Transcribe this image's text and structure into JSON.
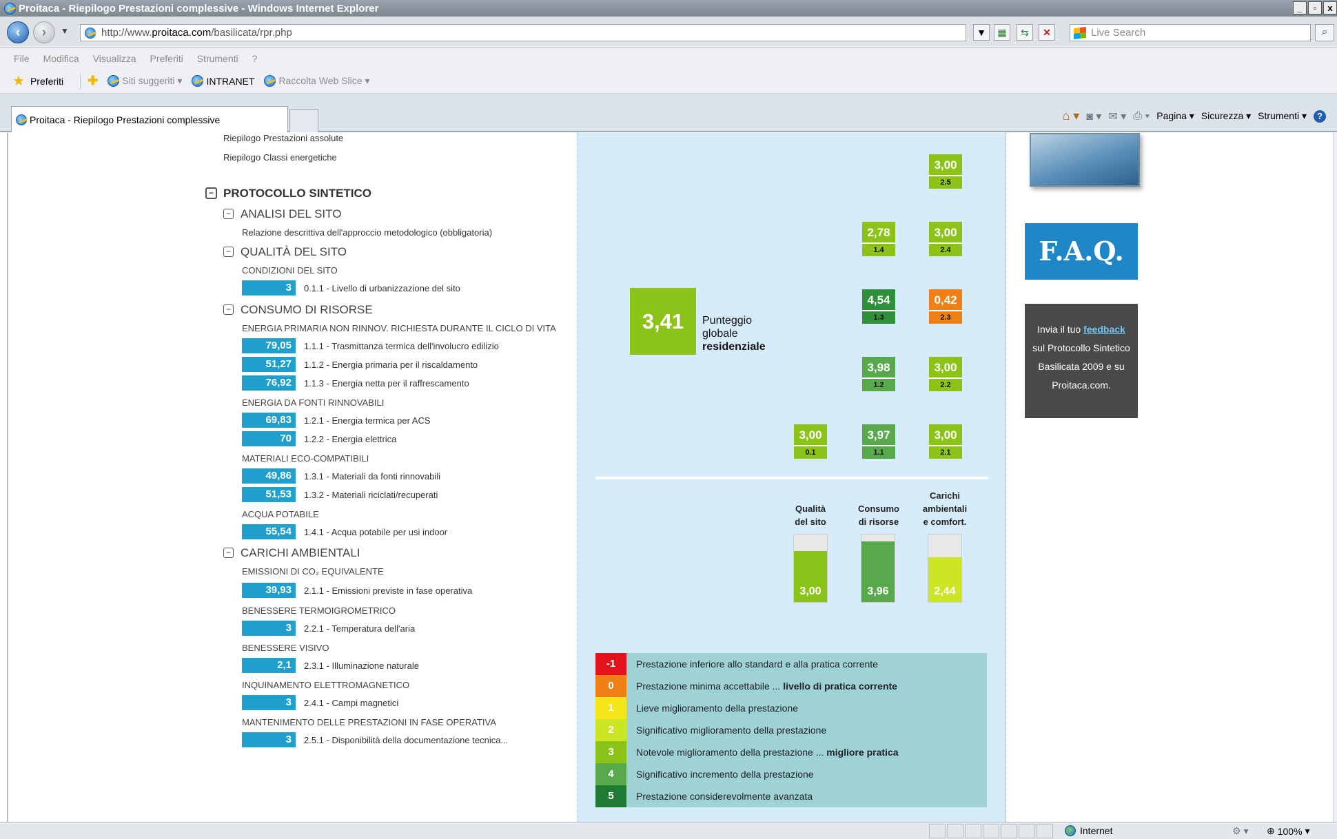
{
  "window": {
    "title": "Proitaca - Riepilogo Prestazioni complessive - Windows Internet Explorer",
    "controls": [
      "_",
      "▫",
      "x"
    ]
  },
  "address_bar": {
    "url_prefix": "http://www.",
    "url_domain": "proitaca.com",
    "url_path": "/basilicata/rpr.php",
    "search_placeholder": "Live Search"
  },
  "menu": [
    "File",
    "Modifica",
    "Visualizza",
    "Preferiti",
    "Strumenti",
    "?"
  ],
  "favorites_bar": {
    "favorites": "Preferiti",
    "items": [
      "Siti suggeriti ▾",
      "INTRANET",
      "Raccolta Web Slice ▾"
    ]
  },
  "tab": {
    "title": "Proitaca - Riepilogo Prestazioni complessive"
  },
  "command_bar": {
    "items": [
      "Pagina ▾",
      "Sicurezza ▾",
      "Strumenti ▾"
    ]
  },
  "nav": {
    "top_links": [
      "Riepilogo Prestazioni assolute",
      "Riepilogo Classi energetiche"
    ],
    "protocol": "PROTOCOLLO SINTETICO",
    "analisi": {
      "title": "ANALISI DEL SITO",
      "desc": "Relazione descrittiva dell'approccio metodologico (obbligatoria)"
    },
    "qualita": {
      "title": "QUALITÀ DEL SITO",
      "sub": "CONDIZIONI DEL SITO",
      "rows": [
        {
          "value": "3",
          "label": "0.1.1 - Livello di urbanizzazione del sito"
        }
      ]
    },
    "consumo": {
      "title": "CONSUMO DI RISORSE",
      "groups": [
        {
          "sub": "ENERGIA PRIMARIA NON RINNOV. RICHIESTA DURANTE IL CICLO DI VITA",
          "rows": [
            {
              "value": "79,05",
              "label": "1.1.1 - Trasmittanza termica dell'involucro edilizio"
            },
            {
              "value": "51,27",
              "label": "1.1.2 - Energia primaria per il riscaldamento"
            },
            {
              "value": "76,92",
              "label": "1.1.3 - Energia netta per il raffrescamento"
            }
          ]
        },
        {
          "sub": "ENERGIA DA FONTI RINNOVABILI",
          "rows": [
            {
              "value": "69,83",
              "label": "1.2.1 - Energia termica per ACS"
            },
            {
              "value": "70",
              "label": "1.2.2 - Energia elettrica"
            }
          ]
        },
        {
          "sub": "MATERIALI ECO-COMPATIBILI",
          "rows": [
            {
              "value": "49,86",
              "label": "1.3.1 - Materiali da fonti rinnovabili"
            },
            {
              "value": "51,53",
              "label": "1.3.2 - Materiali riciclati/recuperati"
            }
          ]
        },
        {
          "sub": "ACQUA POTABILE",
          "rows": [
            {
              "value": "55,54",
              "label": "1.4.1 - Acqua potabile per usi indoor"
            }
          ]
        }
      ]
    },
    "carichi": {
      "title": "CARICHI AMBIENTALI",
      "groups": [
        {
          "sub": "EMISSIONI DI CO₂ EQUIVALENTE",
          "rows": [
            {
              "value": "39,93",
              "label": "2.1.1 - Emissioni previste in fase operativa"
            }
          ]
        },
        {
          "sub": "BENESSERE TERMOIGROMETRICO",
          "rows": [
            {
              "value": "3",
              "label": "2.2.1 - Temperatura dell'aria"
            }
          ]
        },
        {
          "sub": "BENESSERE VISIVO",
          "rows": [
            {
              "value": "2,1",
              "label": "2.3.1 - Illuminazione naturale"
            }
          ]
        },
        {
          "sub": "INQUINAMENTO ELETTROMAGNETICO",
          "rows": [
            {
              "value": "3",
              "label": "2.4.1 - Campi magnetici"
            }
          ]
        },
        {
          "sub": "MANTENIMENTO DELLE PRESTAZIONI IN FASE OPERATIVA",
          "rows": [
            {
              "value": "3",
              "label": "2.5.1 - Disponibilità della documentazione tecnica..."
            }
          ]
        }
      ]
    }
  },
  "scores": [
    {
      "value": "3,00",
      "code": "2.5",
      "color": "#8cc319"
    },
    {
      "value": "2,78",
      "code": "1.4",
      "color": "#8cc319"
    },
    {
      "value": "3,00",
      "code": "2.4",
      "color": "#8cc319"
    },
    {
      "value": "4,54",
      "code": "1.3",
      "color": "#2f8f3a"
    },
    {
      "value": "0,42",
      "code": "2.3",
      "color": "#f07f16"
    },
    {
      "value": "3,98",
      "code": "1.2",
      "color": "#58a94c"
    },
    {
      "value": "3,00",
      "code": "2.2",
      "color": "#8cc319"
    },
    {
      "value": "3,00",
      "code": "0.1",
      "color": "#8cc319"
    },
    {
      "value": "3,97",
      "code": "1.1",
      "color": "#58a94c"
    },
    {
      "value": "3,00",
      "code": "2.1",
      "color": "#8cc319"
    }
  ],
  "global": {
    "value": "3,41",
    "label1": "Punteggio",
    "label2": "globale",
    "label3": "residenziale",
    "color": "#8cc319"
  },
  "summary_bars": [
    {
      "head": [
        "",
        "Qualità",
        "del sito"
      ],
      "value": "3,00",
      "fill_fraction": 0.76,
      "color": "#8cc319"
    },
    {
      "head": [
        "",
        "Consumo",
        "di risorse"
      ],
      "value": "3,96",
      "fill_fraction": 0.9,
      "color": "#58a94c"
    },
    {
      "head": [
        "Carichi",
        "ambientali",
        "e comfort."
      ],
      "value": "2,44",
      "fill_fraction": 0.66,
      "color": "#cbe624"
    }
  ],
  "legend": [
    {
      "score": "-1",
      "text": "Prestazione inferiore allo standard e alla pratica corrente",
      "bold": "",
      "color": "#e3131b"
    },
    {
      "score": "0",
      "text": "Prestazione minima accettabile ... ",
      "bold": "livello di pratica corrente",
      "color": "#f07f16"
    },
    {
      "score": "1",
      "text": "Lieve miglioramento della prestazione",
      "bold": "",
      "color": "#f6e51a"
    },
    {
      "score": "2",
      "text": "Significativo miglioramento della prestazione",
      "bold": "",
      "color": "#cbe624"
    },
    {
      "score": "3",
      "text": "Notevole miglioramento della prestazione ... ",
      "bold": "migliore pratica",
      "color": "#8cc319"
    },
    {
      "score": "4",
      "text": "Significativo incremento della prestazione",
      "bold": "",
      "color": "#58a94c"
    },
    {
      "score": "5",
      "text": "Prestazione considerevolmente avanzata",
      "bold": "",
      "color": "#1f7a33"
    }
  ],
  "sidebar": {
    "faq": "F.A.Q.",
    "feedback_pre": "Invia il tuo ",
    "feedback_link": "feedback",
    "feedback_l2": "sul Protocollo Sintetico",
    "feedback_l3": "Basilicata 2009 e su",
    "feedback_l4": "Proitaca.com."
  },
  "status": {
    "zone": "Internet",
    "zoom": "100%"
  }
}
